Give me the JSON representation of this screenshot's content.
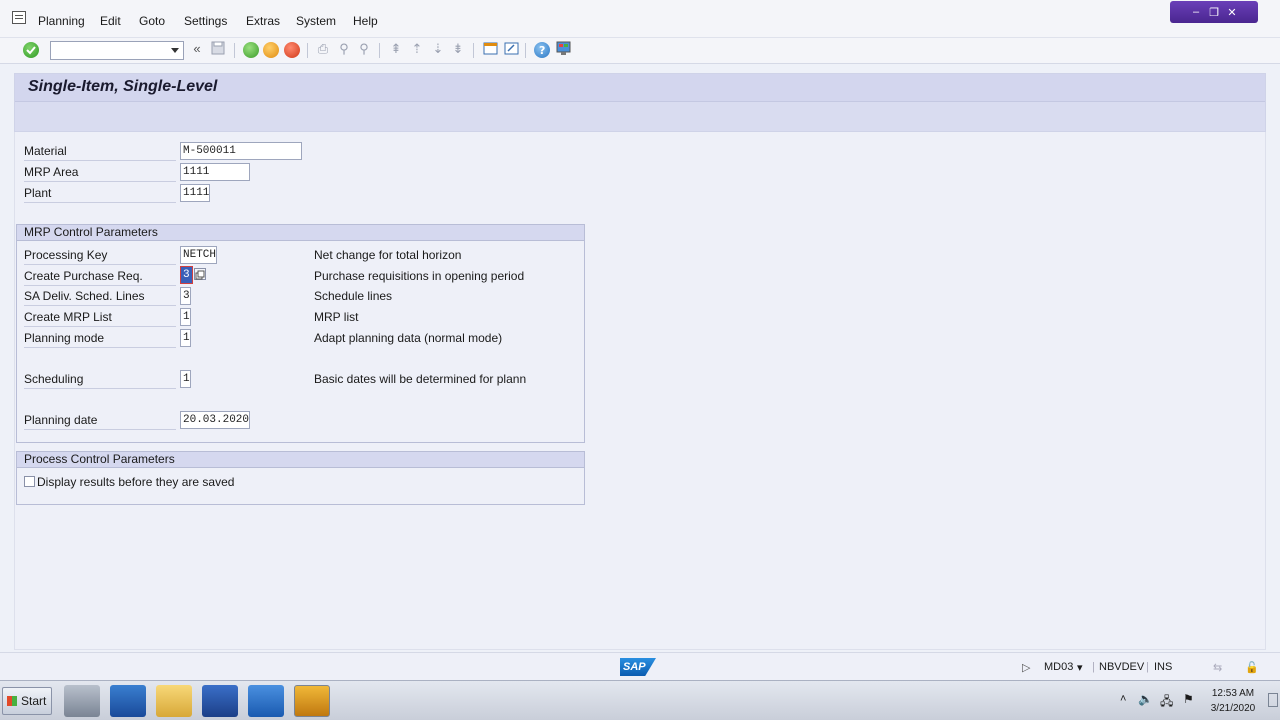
{
  "menu": [
    "Planning",
    "Edit",
    "Goto",
    "Settings",
    "Extras",
    "System",
    "Help"
  ],
  "window_controls": [
    "–",
    "❐",
    "✕"
  ],
  "page_title": "Single-Item, Single-Level",
  "header_fields": [
    {
      "label": "Material",
      "value": "M-500011"
    },
    {
      "label": "MRP Area",
      "value": "1111"
    },
    {
      "label": "Plant",
      "value": "1111"
    }
  ],
  "mrp_group": {
    "title": "MRP Control Parameters",
    "rows": [
      {
        "label": "Processing Key",
        "value": "NETCH",
        "desc": "Net change for total horizon"
      },
      {
        "label": "Create Purchase Req.",
        "value": "3",
        "desc": "Purchase requisitions in opening period"
      },
      {
        "label": "SA Deliv. Sched. Lines",
        "value": "3",
        "desc": "Schedule lines"
      },
      {
        "label": "Create MRP List",
        "value": "1",
        "desc": "MRP list"
      },
      {
        "label": "Planning mode",
        "value": "1",
        "desc": "Adapt planning data (normal mode)"
      },
      {
        "label": "Scheduling",
        "value": "1",
        "desc": "Basic dates will be determined for plann"
      },
      {
        "label": "Planning date",
        "value": "20.03.2020",
        "desc": ""
      }
    ]
  },
  "process_group": {
    "title": "Process Control Parameters",
    "checkbox_label": "Display results before they are saved",
    "checked": false
  },
  "statusbar": {
    "logo": "SAP",
    "transaction": "MD03",
    "system": "NBVDEV",
    "mode": "INS"
  },
  "taskbar": {
    "start": "Start",
    "time": "12:53 AM",
    "date": "3/21/2020"
  }
}
